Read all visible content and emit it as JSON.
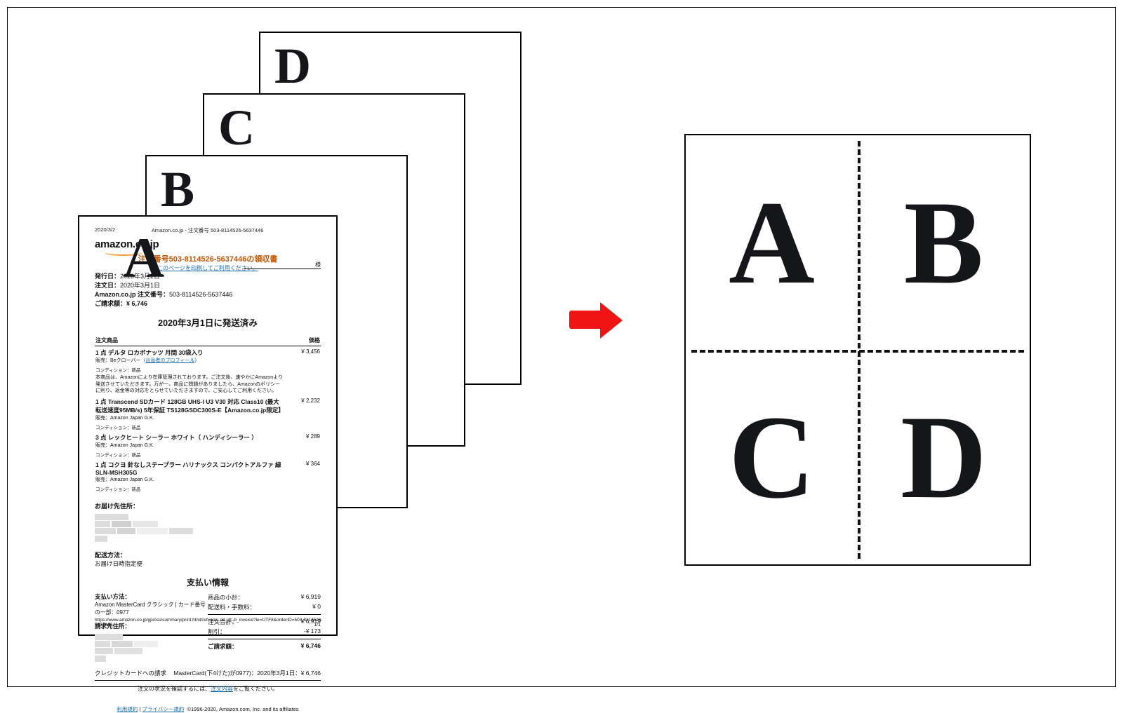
{
  "stack": {
    "labels": [
      "A",
      "B",
      "C",
      "D"
    ]
  },
  "invoice": {
    "top_date": "2020/3/2",
    "top_center": "Amazon.co.jp - 注文番号 503-8114526-5637446",
    "logo_text": "amazon.co.jp",
    "title": "注文番号503-8114526-5637446の領収書",
    "subtitle": "このページを印刷してご利用ください。",
    "meta": {
      "issued_label": "発行日：",
      "issued_value": "2020年3月2日",
      "order_date_label": "注文日：",
      "order_date_value": "2020年3月1日",
      "order_no_label": "Amazon.co.jp 注文番号：",
      "order_no_value": "503-8114526-5637446",
      "total_label": "ご請求額：",
      "total_value": "¥ 6,746"
    },
    "sama": "様",
    "shipped": "2020年3月1日に発送済み",
    "table": {
      "col_item": "注文商品",
      "col_price": "価格",
      "items": [
        {
          "name": "1 点  デルタ ロカボナッツ 月間 30袋入り",
          "seller_prefix": "販売：Beクローバー（",
          "seller_link": "出品者のプロフィール",
          "seller_suffix": "）",
          "cond": "コンディション：新品",
          "note": "本商品は、Amazonにより在庫管理されております。ご注文後、速やかにAmazonより発送させていただきます。万が一、商品に問題がありましたら、Amazonのポリシーに則り、返金等の対応をとらせていただきますので、ご安心してご利用ください。",
          "price": "¥ 3,456"
        },
        {
          "name": "1 点  Transcend SDカード 128GB UHS-I U3 V30 対応 Class10 (最大転送速度95MB/s) 5年保証 TS128GSDC300S-E【Amazon.co.jp限定】",
          "seller_prefix": "販売：Amazon Japan G.K.",
          "seller_link": "",
          "seller_suffix": "",
          "cond": "コンディション：新品",
          "note": "",
          "price": "¥ 2,232"
        },
        {
          "name": "3 点  レックヒート シーラー ホワイト（ ハンディシーラー ）",
          "seller_prefix": "販売：Amazon Japan G.K.",
          "seller_link": "",
          "seller_suffix": "",
          "cond": "コンディション：新品",
          "note": "",
          "price": "¥ 289"
        },
        {
          "name": "1 点  コクヨ 針なしステープラー ハリナックス コンパクトアルファ 緑 SLN-MSH305G",
          "seller_prefix": "販売：Amazon Japan G.K.",
          "seller_link": "",
          "seller_suffix": "",
          "cond": "コンディション：新品",
          "note": "",
          "price": "¥ 364"
        }
      ]
    },
    "address_h": "お届け先住所：",
    "shipmethod_h": "配送方法：",
    "shipmethod_v": "お届け日時指定便",
    "pay_h": "支払い情報",
    "pay_left": {
      "method_h": "支払い方法：",
      "method_v": "Amazon MasterCard クラシック | カード番号の一部：0977",
      "billto_h": "請求先住所："
    },
    "pay_right": {
      "r1l": "商品の小計：",
      "r1v": "¥ 6,919",
      "r2l": "配送料・手数料：",
      "r2v": "¥ 0",
      "r3l": "注文合計：",
      "r3v": "¥ 6,919",
      "r4l": "割引：",
      "r4v": "-¥ 173",
      "r5l": "ご請求額：",
      "r5v": "¥ 6,746"
    },
    "cc_l": "クレジットカードへの請求",
    "cc_r": "MasterCard(下4けた)が0977)：2020年3月1日：¥ 6,746",
    "confirm_pre": "注文の状況を確認するには、",
    "confirm_link": "注文内容",
    "confirm_post": "をご覧ください。",
    "footer": {
      "link1": "利用規約",
      "link2": "プライバシー規約",
      "copy": "©1996-2020, Amazon.com, Inc. and its affiliates",
      "url": "https://www.amazon.co.jp/gp/css/summary/print.html/ref=ppx_od_dt_b_invoice?ie=UTF8&orderID=503-8114526-5637446",
      "page": "1/1"
    }
  },
  "fourup": {
    "cells": [
      "A",
      "B",
      "C",
      "D"
    ]
  }
}
